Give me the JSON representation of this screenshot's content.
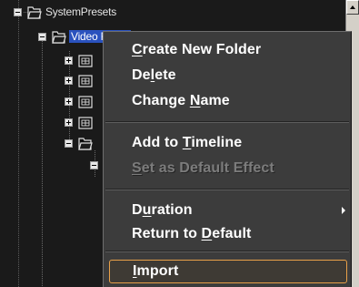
{
  "tree": {
    "items": [
      {
        "label": "SystemPresets"
      },
      {
        "label": "Video Filters"
      }
    ]
  },
  "menu": {
    "items": [
      {
        "pre": "",
        "key": "C",
        "post": "reate New Folder"
      },
      {
        "pre": "De",
        "key": "l",
        "post": "ete"
      },
      {
        "pre": "Change ",
        "key": "N",
        "post": "ame"
      },
      {
        "pre": "Add to ",
        "key": "T",
        "post": "imeline"
      },
      {
        "pre": "",
        "key": "S",
        "post": "et as Default Effect"
      },
      {
        "pre": "D",
        "key": "u",
        "post": "ration"
      },
      {
        "pre": "Return to ",
        "key": "D",
        "post": "efault"
      },
      {
        "pre": "",
        "key": "I",
        "post": "mport"
      }
    ]
  }
}
